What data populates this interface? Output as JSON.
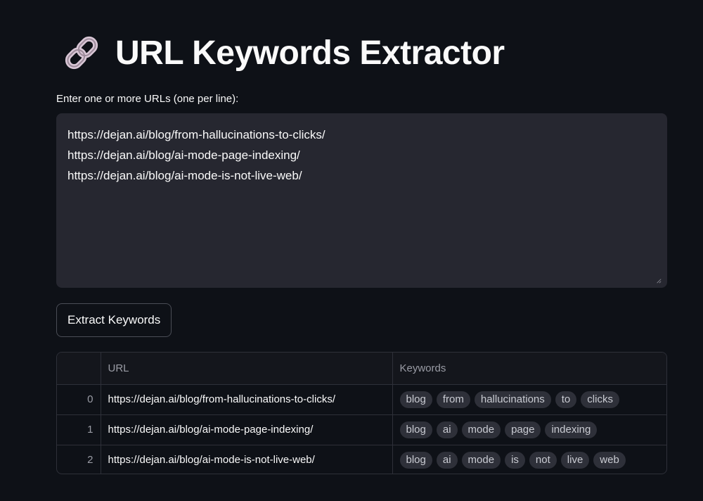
{
  "header": {
    "icon": "link-icon",
    "title": "URL Keywords Extractor"
  },
  "input": {
    "label": "Enter one or more URLs (one per line):",
    "value": "https://dejan.ai/blog/from-hallucinations-to-clicks/\nhttps://dejan.ai/blog/ai-mode-page-indexing/\nhttps://dejan.ai/blog/ai-mode-is-not-live-web/"
  },
  "button": {
    "label": "Extract Keywords"
  },
  "table": {
    "columns": [
      "",
      "URL",
      "Keywords"
    ],
    "rows": [
      {
        "index": "0",
        "url": "https://dejan.ai/blog/from-hallucinations-to-clicks/",
        "keywords": [
          "blog",
          "from",
          "hallucinations",
          "to",
          "clicks"
        ]
      },
      {
        "index": "1",
        "url": "https://dejan.ai/blog/ai-mode-page-indexing/",
        "keywords": [
          "blog",
          "ai",
          "mode",
          "page",
          "indexing"
        ]
      },
      {
        "index": "2",
        "url": "https://dejan.ai/blog/ai-mode-is-not-live-web/",
        "keywords": [
          "blog",
          "ai",
          "mode",
          "is",
          "not",
          "live",
          "web"
        ]
      }
    ]
  },
  "colors": {
    "background": "#0e1117",
    "input_background": "#262730",
    "chip_background": "#2e3039",
    "link_icon": "#d9c7d6"
  }
}
